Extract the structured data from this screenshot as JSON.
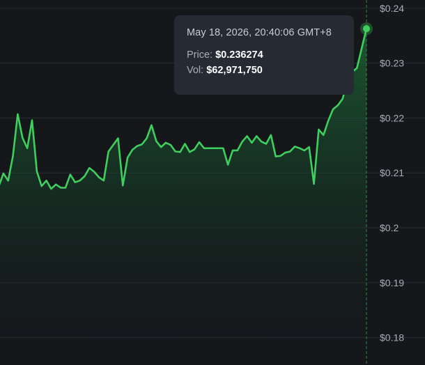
{
  "tooltip": {
    "date": "May 18, 2026, 20:40:06 GMT+8",
    "price_label": "Price:",
    "price_value": "$0.236274",
    "vol_label": "Vol:",
    "vol_value": "$62,971,750"
  },
  "colors": {
    "background": "#15171b",
    "line": "#3ecf5e",
    "grid": "#2a2e34",
    "crosshair": "#2f8a45"
  },
  "chart_data": {
    "type": "area",
    "title": "",
    "xlabel": "",
    "ylabel": "",
    "ylim": [
      0.175,
      0.2415
    ],
    "y_ticks": [
      "$0.24",
      "$0.23",
      "$0.22",
      "$0.21",
      "$0.2",
      "$0.19",
      "$0.18"
    ],
    "y_tick_values": [
      0.24,
      0.23,
      0.22,
      0.21,
      0.2,
      0.19,
      0.18
    ],
    "grid": true,
    "series": [
      {
        "values": [
          0.2075,
          0.2099,
          0.2086,
          0.2131,
          0.2207,
          0.2164,
          0.2145,
          0.2196,
          0.2103,
          0.2076,
          0.2086,
          0.2071,
          0.2079,
          0.2073,
          0.2073,
          0.2097,
          0.2083,
          0.2086,
          0.2094,
          0.2109,
          0.2102,
          0.2092,
          0.2086,
          0.2139,
          0.2151,
          0.2163,
          0.2077,
          0.2128,
          0.2142,
          0.2149,
          0.2152,
          0.2163,
          0.2187,
          0.2158,
          0.2147,
          0.2155,
          0.2151,
          0.2139,
          0.2138,
          0.2153,
          0.2138,
          0.2143,
          0.2156,
          0.2145,
          0.2145,
          0.2145,
          0.2145,
          0.2145,
          0.2115,
          0.2141,
          0.2141,
          0.2157,
          0.2167,
          0.2155,
          0.2167,
          0.2157,
          0.2153,
          0.2169,
          0.213,
          0.2131,
          0.2137,
          0.2139,
          0.2148,
          0.2145,
          0.2141,
          0.2147,
          0.208,
          0.2179,
          0.2169,
          0.2195,
          0.2216,
          0.2223,
          0.2235,
          0.2266,
          0.2284,
          0.2291,
          0.2327,
          0.2363
        ]
      }
    ],
    "highlight": {
      "value": 0.236274,
      "index": 77
    }
  }
}
